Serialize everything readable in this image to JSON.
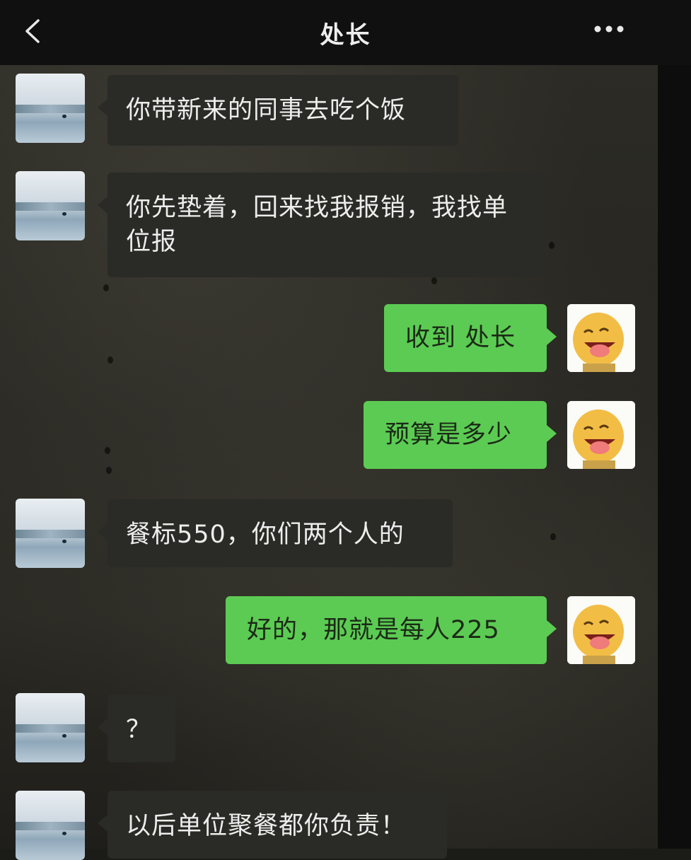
{
  "header": {
    "title": "处长"
  },
  "icons": {
    "back": "back-chevron-icon",
    "more": "more-dots-icon"
  },
  "colors": {
    "sent_bubble": "#5ccb53",
    "received_bubble": "#2a2a26"
  },
  "messages": [
    {
      "side": "left",
      "text": "你带新来的同事去吃个饭"
    },
    {
      "side": "left",
      "text": "你先垫着，回来找我报销，我找单位报"
    },
    {
      "side": "right",
      "text": "收到 处长"
    },
    {
      "side": "right",
      "text": "预算是多少"
    },
    {
      "side": "left",
      "text": "餐标550，你们两个人的"
    },
    {
      "side": "right",
      "text": "好的，那就是每人225"
    },
    {
      "side": "left",
      "text": "？"
    },
    {
      "side": "left",
      "text": "以后单位聚餐都你负责！"
    }
  ]
}
